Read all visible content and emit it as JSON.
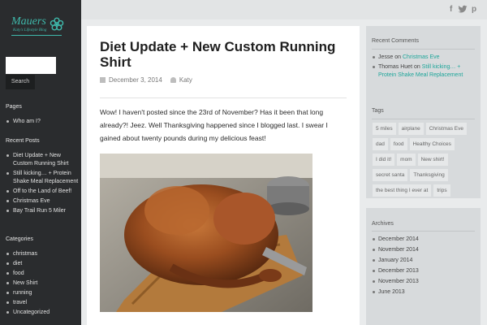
{
  "site": {
    "logo_title": "Mauers",
    "logo_subtitle": "Katy's Lifestyle Blog"
  },
  "sidebar": {
    "search_button": "Search",
    "pages_heading": "Pages",
    "pages": [
      "Who am I?"
    ],
    "recent_posts_heading": "Recent Posts",
    "recent_posts": [
      "Diet Update + New Custom Running Shirt",
      "Still kicking… + Protein Shake Meal Replacement",
      "Off to the Land of Beef!",
      "Christmas Eve",
      "Bay Trail Run 5 Miler"
    ],
    "categories_heading": "Categories",
    "categories": [
      "christmas",
      "diet",
      "food",
      "New Shirt",
      "running",
      "travel",
      "Uncategorized"
    ]
  },
  "topbar": {
    "social_icons": [
      "facebook-icon",
      "twitter-icon",
      "pinterest-icon"
    ],
    "facebook": "f",
    "twitter": "t",
    "pinterest": "p"
  },
  "post": {
    "title": "Diet Update + New Custom Running Shirt",
    "date": "December 3, 2014",
    "author": "Katy",
    "body": "Wow! I haven't posted since the 23rd of November? Has it been that long already?! Jeez. Well Thanksgiving happened since I blogged last. I swear I gained about twenty pounds during my delicious feast!"
  },
  "recent_comments": {
    "heading": "Recent Comments",
    "items": [
      {
        "author": "Jesse",
        "on": "on",
        "post": "Christmas Eve"
      },
      {
        "author": "Thomas Huet",
        "on": "on",
        "post": "Still kicking… + Protein Shake Meal Replacement"
      }
    ]
  },
  "tags": {
    "heading": "Tags",
    "items": [
      "5 miles",
      "airplane",
      "Christmas Eve",
      "dad",
      "food",
      "Healthy Choices",
      "I did it!",
      "mom",
      "New shirt!",
      "secret santa",
      "Thanksgiving",
      "the best thing I ever at",
      "trips"
    ]
  },
  "archives": {
    "heading": "Archives",
    "items": [
      "December 2014",
      "November 2014",
      "January 2014",
      "December 2013",
      "November 2013",
      "June 2013"
    ]
  },
  "colors": {
    "accent": "#1ea69a",
    "sidebar_bg": "#2a2c2e"
  }
}
